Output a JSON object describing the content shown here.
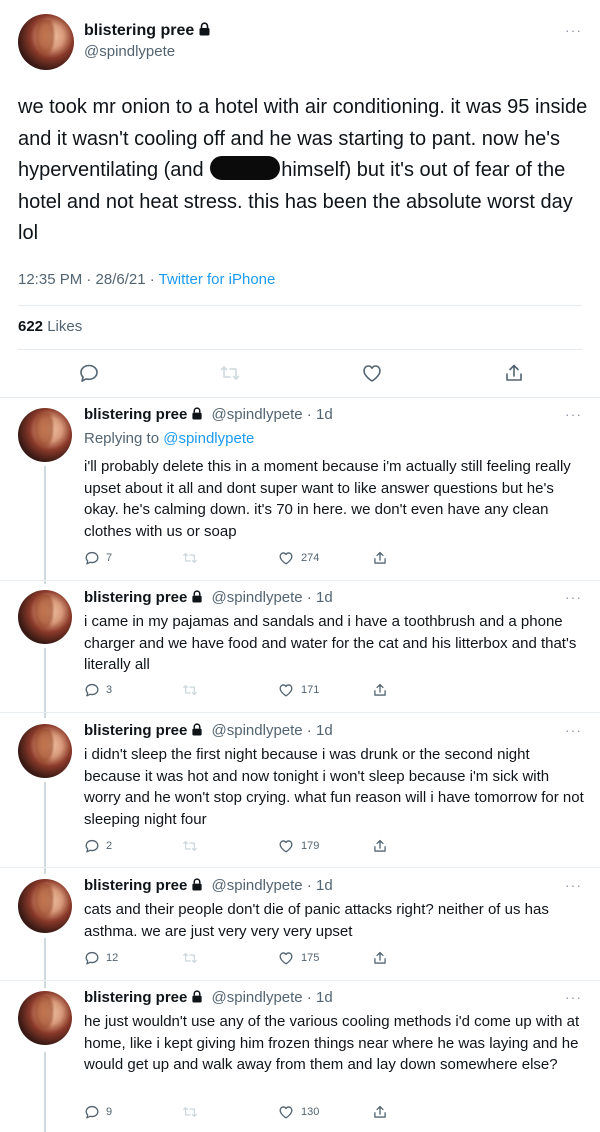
{
  "main_tweet": {
    "display_name": "blistering pree",
    "handle": "@spindlypete",
    "text_1": "we took mr onion to a hotel with air conditioning. it was 95 inside and it wasn't cooling off and he was starting to pant. now he's hyperventilating (and ",
    "text_2": "himself) but it's out of fear of the hotel and not heat stress. this has been the absolute worst day lol",
    "time": "12:35 PM · 28/6/21 · ",
    "source": "Twitter for iPhone",
    "likes_count": "622",
    "likes_label": " Likes"
  },
  "replies": [
    {
      "display_name": "blistering pree",
      "handle_time": "@spindlypete · 1d",
      "replying_prefix": "Replying to ",
      "replying_to": "@spindlypete",
      "text": "i'll probably delete this in a moment because i'm actually still feeling really upset about it all and dont super want to like answer questions but he's okay. he's calming down. it's 70 in here. we don't even have any clean clothes with us or soap",
      "replies_count": "7",
      "retweets_count": "",
      "likes_count": "274"
    },
    {
      "display_name": "blistering pree",
      "handle_time": "@spindlypete · 1d",
      "text": "i came in my pajamas and sandals and i have a toothbrush and a phone charger and we have food and water for the cat and his litterbox and that's literally all",
      "replies_count": "3",
      "retweets_count": "",
      "likes_count": "171"
    },
    {
      "display_name": "blistering pree",
      "handle_time": "@spindlypete · 1d",
      "text": "i didn't sleep the first night because i was drunk or the second night because it was hot and now tonight i won't sleep because i'm sick with worry and he won't stop crying. what fun reason will i have tomorrow for not sleeping night four",
      "replies_count": "2",
      "retweets_count": "",
      "likes_count": "179"
    },
    {
      "display_name": "blistering pree",
      "handle_time": "@spindlypete · 1d",
      "text": "cats and their people don't die of panic attacks right? neither of us has asthma. we are just very very very upset",
      "replies_count": "12",
      "retweets_count": "",
      "likes_count": "175"
    },
    {
      "display_name": "blistering pree",
      "handle_time": "@spindlypete · 1d",
      "text": "he just wouldn't use any of the various cooling methods i'd come up with at home, like i kept giving him frozen things near where he was laying and he would get up and walk away from them and lay down somewhere else?",
      "replies_count": "9",
      "retweets_count": "",
      "likes_count": "130"
    }
  ],
  "more_glyph": "···",
  "icons": [
    "lock-icon",
    "reply-icon",
    "retweet-icon",
    "like-icon",
    "share-icon",
    "more-icon"
  ],
  "colors": {
    "link": "#1d9bf0",
    "muted": "#536471",
    "divider": "#e6ecf0",
    "text": "#0f1419"
  }
}
